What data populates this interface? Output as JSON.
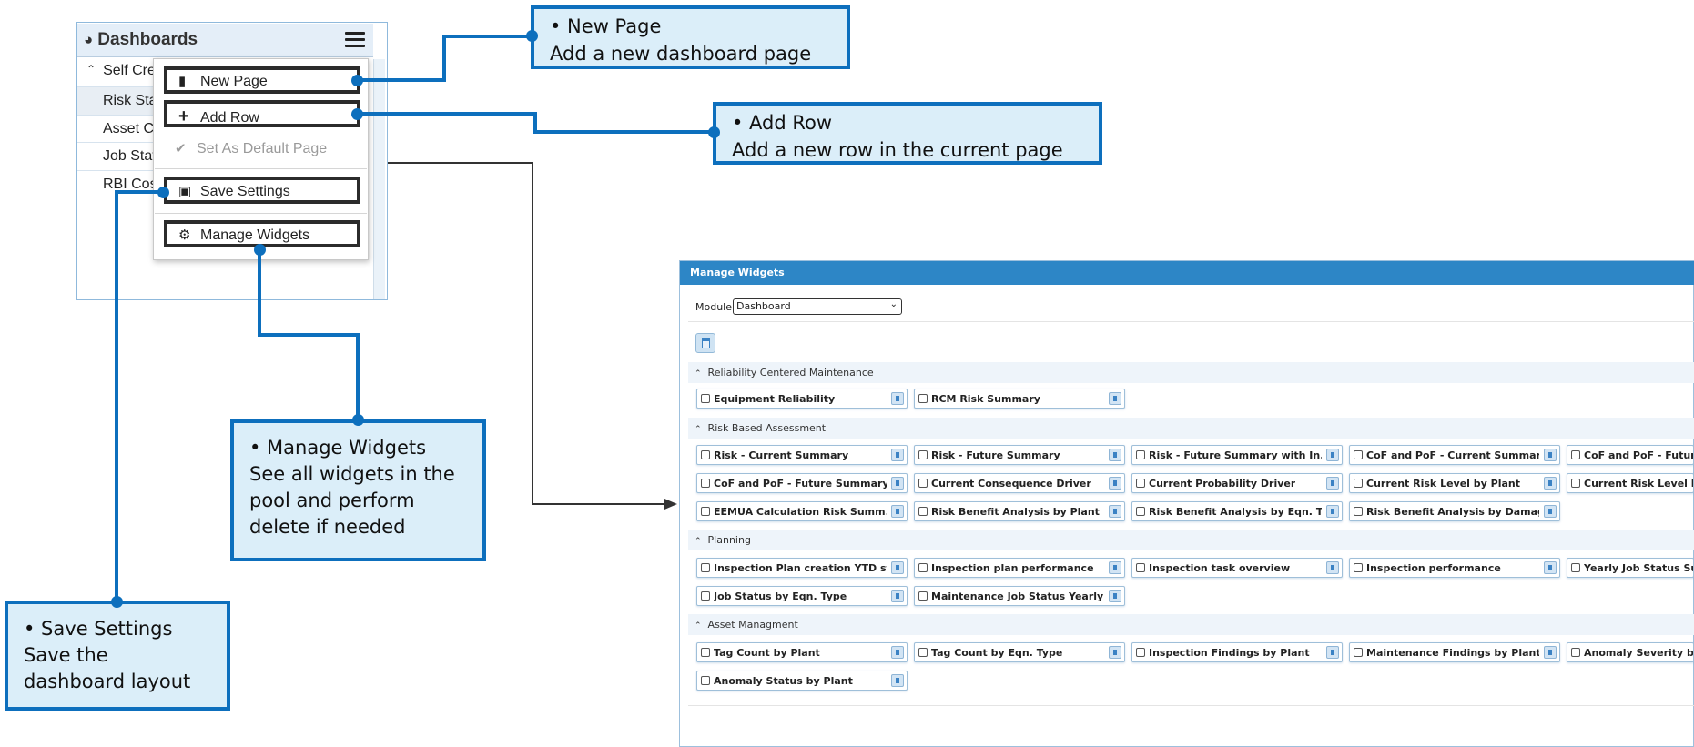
{
  "dashboard_panel": {
    "title": "Dashboards",
    "group": "Self Cre",
    "pages": [
      "Risk Sta",
      "Asset C",
      "Job Stat",
      "RBI Cos"
    ]
  },
  "menu": {
    "new_page": "New Page",
    "add_row": "Add Row",
    "set_default": "Set As Default Page",
    "save_settings": "Save Settings",
    "manage_widgets": "Manage Widgets"
  },
  "callouts": {
    "new_page": "•  New Page\nAdd a new dashboard page",
    "add_row": "•  Add Row\nAdd a new row in the current page",
    "manage_widgets": "•  Manage Widgets\nSee all widgets in the\npool and perform\ndelete if needed",
    "save_settings": "•  Save Settings\nSave the\ndashboard layout"
  },
  "manage_widgets": {
    "title": "Manage Widgets",
    "module_label": "Module",
    "module_value": "Dashboard",
    "groups": [
      {
        "name": "Reliability Centered Maintenance",
        "rows": [
          [
            "Equipment Reliability",
            "RCM Risk Summary"
          ]
        ]
      },
      {
        "name": "Risk Based Assessment",
        "rows": [
          [
            "Risk - Current Summary",
            "Risk - Future Summary",
            "Risk - Future Summary with In...",
            "CoF and PoF - Current Summary",
            "CoF and PoF - Futur"
          ],
          [
            "CoF and PoF - Future Summary...",
            "Current Consequence Driver",
            "Current Probability Driver",
            "Current Risk Level by Plant",
            "Current Risk Level b"
          ],
          [
            "EEMUA Calculation Risk Summ...",
            "Risk Benefit Analysis by Plant",
            "Risk Benefit Analysis by Eqn. T...",
            "Risk Benefit Analysis by Damage"
          ]
        ]
      },
      {
        "name": "Planning",
        "rows": [
          [
            "Inspection Plan creation YTD st...",
            "Inspection plan performance",
            "Inspection task overview",
            "Inspection performance",
            "Yearly Job Status Su"
          ],
          [
            "Job Status by Eqn. Type",
            "Maintenance Job Status Yearly"
          ]
        ]
      },
      {
        "name": "Asset Managment",
        "rows": [
          [
            "Tag Count by Plant",
            "Tag Count by Eqn. Type",
            "Inspection Findings by Plant",
            "Maintenance Findings by Plant",
            "Anomaly Severity by"
          ],
          [
            "Anomaly Status by Plant"
          ]
        ]
      }
    ]
  },
  "colors": {
    "callout_border": "#0d6fbd",
    "callout_fill": "#dbeef9",
    "titlebar": "#2d86c6"
  }
}
